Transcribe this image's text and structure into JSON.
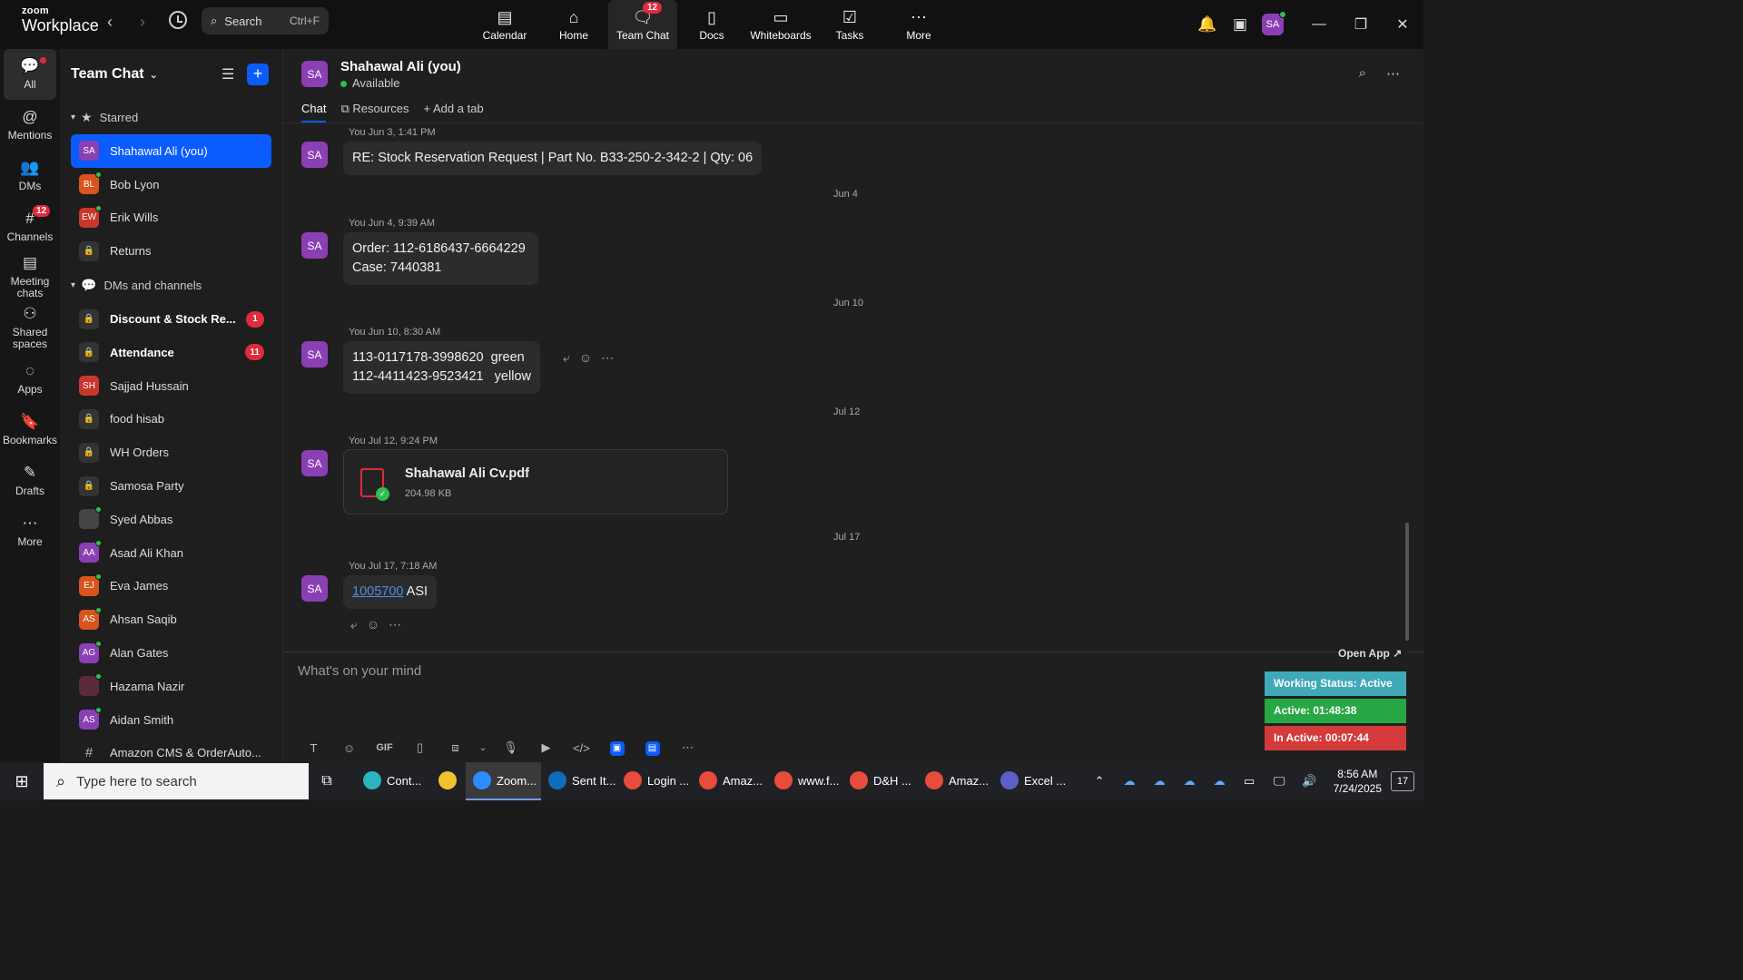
{
  "app": {
    "logo_line1": "zoom",
    "logo_line2": "Workplace",
    "search_label": "Search",
    "search_shortcut": "Ctrl+F"
  },
  "topnav": [
    {
      "label": "Calendar",
      "icon": "calendar-icon",
      "glyph": "▤"
    },
    {
      "label": "Home",
      "icon": "home-icon",
      "glyph": "⌂"
    },
    {
      "label": "Team Chat",
      "icon": "chat-icon",
      "glyph": "🗨",
      "badge": "12",
      "active": true
    },
    {
      "label": "Docs",
      "icon": "docs-icon",
      "glyph": "▯"
    },
    {
      "label": "Whiteboards",
      "icon": "whiteboard-icon",
      "glyph": "▭"
    },
    {
      "label": "Tasks",
      "icon": "tasks-icon",
      "glyph": "☑"
    },
    {
      "label": "More",
      "icon": "more-icon",
      "glyph": "⋯"
    }
  ],
  "user_avatar": "SA",
  "rail": [
    {
      "label": "All",
      "icon": "chat-bubble-icon",
      "glyph": "💬",
      "active": true,
      "dot": true
    },
    {
      "label": "Mentions",
      "icon": "at-icon",
      "glyph": "@"
    },
    {
      "label": "DMs",
      "icon": "people-icon",
      "glyph": "👥"
    },
    {
      "label": "Channels",
      "icon": "hash-icon",
      "glyph": "#",
      "badge": "12"
    },
    {
      "label": "Meeting chats",
      "icon": "meeting-icon",
      "glyph": "▤"
    },
    {
      "label": "Shared spaces",
      "icon": "shared-spaces-icon",
      "glyph": "⚇"
    },
    {
      "label": "Apps",
      "icon": "apps-icon",
      "glyph": "◌"
    },
    {
      "label": "Bookmarks",
      "icon": "bookmark-icon",
      "glyph": "🔖"
    },
    {
      "label": "Drafts",
      "icon": "drafts-icon",
      "glyph": "✎"
    },
    {
      "label": "More",
      "icon": "more-icon",
      "glyph": "⋯"
    }
  ],
  "sidebar": {
    "title": "Team Chat",
    "starred_label": "Starred",
    "dms_label": "DMs and channels",
    "starred": [
      {
        "name": "Shahawal Ali (you)",
        "initials": "SA",
        "color": "#8b3fb5",
        "online": false,
        "selected": true
      },
      {
        "name": "Bob Lyon",
        "initials": "BL",
        "color": "#d9541e",
        "online": true
      },
      {
        "name": "Erik Wills",
        "initials": "EW",
        "color": "#c9362b",
        "online": true
      },
      {
        "name": "Returns",
        "lock": true
      }
    ],
    "channels": [
      {
        "name": "Discount & Stock Re...",
        "lock": true,
        "bold": true,
        "count": "1"
      },
      {
        "name": "Attendance",
        "lock": true,
        "bold": true,
        "count": "11"
      },
      {
        "name": "Sajjad Hussain",
        "initials": "SH",
        "color": "#c9362b"
      },
      {
        "name": "food hisab",
        "lock": true
      },
      {
        "name": "WH Orders",
        "lock": true
      },
      {
        "name": "Samosa Party",
        "lock": true
      },
      {
        "name": "Syed Abbas",
        "initials": "",
        "color": "#444",
        "online": true
      },
      {
        "name": "Asad Ali Khan",
        "initials": "AA",
        "color": "#8b3fb5",
        "online": true
      },
      {
        "name": "Eva James",
        "initials": "EJ",
        "color": "#d9541e",
        "online": true
      },
      {
        "name": "Ahsan Saqib",
        "initials": "AS",
        "color": "#d9541e",
        "online": true
      },
      {
        "name": "Alan Gates",
        "initials": "AG",
        "color": "#8b3fb5",
        "online": true
      },
      {
        "name": "Hazama Nazir",
        "initials": "",
        "color": "#5a2a3a",
        "online": true
      },
      {
        "name": "Aidan Smith",
        "initials": "AS",
        "color": "#8b3fb5",
        "online": true
      },
      {
        "name": "Amazon CMS & OrderAuto...",
        "hash": true
      }
    ]
  },
  "channel": {
    "avatar": "SA",
    "name": "Shahawal Ali (you)",
    "status": "Available",
    "tabs": [
      "Chat",
      "Resources",
      "Add a tab"
    ]
  },
  "messages": {
    "m1_meta": "You Jun 3, 1:41 PM",
    "m1_text": "RE: Stock Reservation Request | Part No. B33-250-2-342-2 | Qty: 06",
    "d1": "Jun 4",
    "m2_meta": "You Jun 4, 9:39 AM",
    "m2_text": "Order: 112-6186437-6664229\nCase: 7440381",
    "d2": "Jun 10",
    "m3_meta": "You Jun 10, 8:30 AM",
    "m3_text": "113-0117178-3998620  green\n112-4411423-9523421   yellow",
    "d3": "Jul 12",
    "m4_meta": "You Jul 12, 9:24 PM",
    "m4_file": "Shahawal Ali Cv.pdf",
    "m4_size": "204.98 KB",
    "d4": "Jul 17",
    "m5_meta": "You Jul 17, 7:18 AM",
    "m5_link": "1005700",
    "m5_text": " ASI"
  },
  "composer": {
    "placeholder": "What's on your mind"
  },
  "widget": {
    "open_app": "Open App ↗",
    "working": "Working Status: Active",
    "active": "Active: 01:48:38",
    "inactive": "In Active: 00:07:44",
    "colors": {
      "working": "#3fa9b8",
      "active": "#28a745",
      "inactive": "#d43a3a"
    }
  },
  "taskbar": {
    "search": "Type here to search",
    "apps": [
      {
        "label": "Cont...",
        "color": "#2bb3c0"
      },
      {
        "label": "",
        "color": "#f2c12e",
        "short": true
      },
      {
        "label": "Zoom...",
        "color": "#2d8cff",
        "active": true
      },
      {
        "label": "Sent It...",
        "color": "#0f6cbd"
      },
      {
        "label": "Login ...",
        "color": "#e74c3c"
      },
      {
        "label": "Amaz...",
        "color": "#e74c3c"
      },
      {
        "label": "www.f...",
        "color": "#e74c3c"
      },
      {
        "label": "D&H ...",
        "color": "#e74c3c"
      },
      {
        "label": "Amaz...",
        "color": "#e74c3c"
      },
      {
        "label": "Excel ...",
        "color": "#5b5fc7"
      }
    ],
    "time": "8:56 AM",
    "date": "7/24/2025",
    "notif_count": "17"
  }
}
